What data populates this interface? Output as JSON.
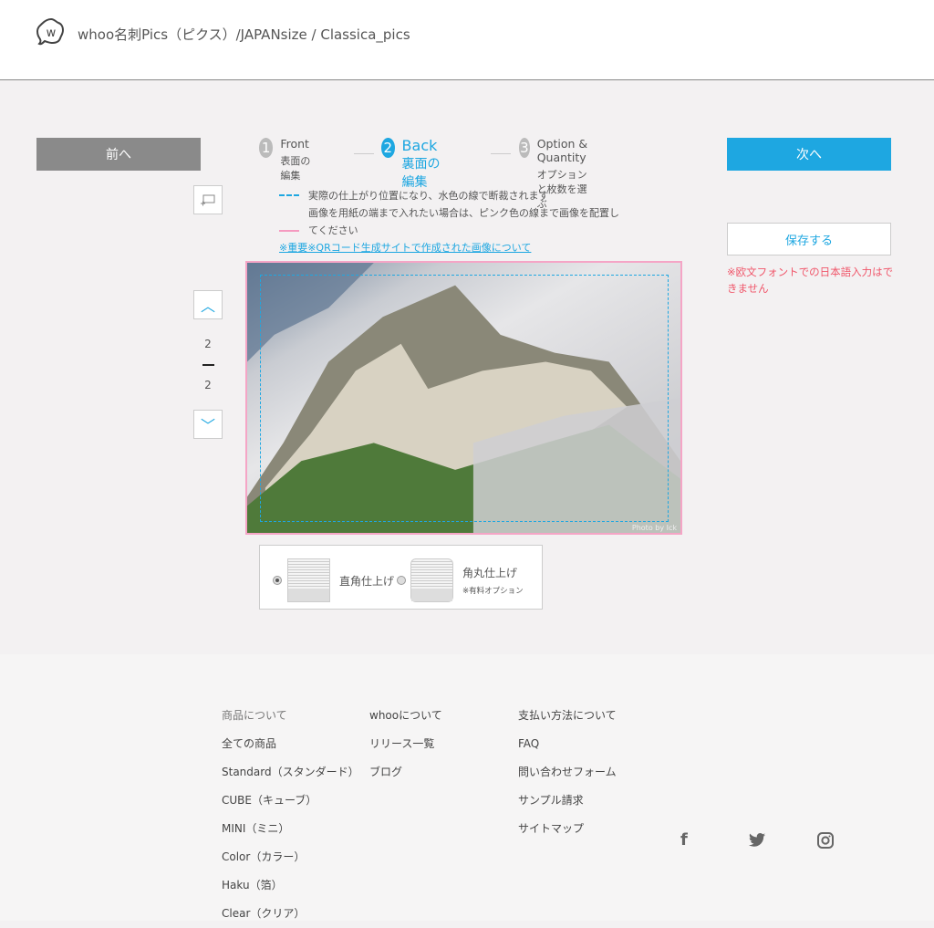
{
  "header": {
    "title": "whoo名刺Pics（ピクス）/JAPANsize / Classica_pics",
    "logo_icon": "whoo-logo"
  },
  "nav": {
    "prev": "前へ",
    "next": "次へ",
    "save": "保存する",
    "warning": "※欧文フォントでの日本語入力はできません"
  },
  "steps": [
    {
      "num": "1",
      "title": "Front",
      "sub": "表面の編集",
      "active": false
    },
    {
      "num": "2",
      "title": "Back",
      "sub": "裏面の編集",
      "active": true
    },
    {
      "num": "3",
      "title": "Option & Quantity",
      "sub": "オプションと枚数を選ぶ",
      "active": false
    }
  ],
  "legend": {
    "blue": "実際の仕上がり位置になり、水色の線で断裁されます",
    "pink": "画像を用紙の端まで入れたい場合は、ピンク色の線まで画像を配置してください",
    "link": "※重要※QRコード生成サイトで作成された画像について"
  },
  "pager": {
    "current": "2",
    "total": "2"
  },
  "canvas": {
    "credit": "Photo by Ick",
    "cut_line_color": "#1ea7e1",
    "bleed_line_color": "#f5a5c6"
  },
  "finish": {
    "square": "直角仕上げ",
    "round": "角丸仕上げ",
    "round_note": "※有料オプション",
    "selected": "square"
  },
  "footer": {
    "col1": [
      "商品について",
      "全ての商品",
      "Standard（スタンダード）",
      "CUBE（キューブ）",
      "MINI（ミニ）",
      "Color（カラー）",
      "Haku（箔）",
      "Clear（クリア）"
    ],
    "col2": [
      "whooについて",
      "リリース一覧",
      "ブログ"
    ],
    "col3": [
      "支払い方法について",
      "FAQ",
      "問い合わせフォーム",
      "サンプル請求",
      "サイトマップ"
    ],
    "social": [
      "facebook-icon",
      "twitter-icon",
      "instagram-icon"
    ]
  },
  "colors": {
    "accent": "#1ea7e1",
    "warning": "#f0566a"
  }
}
